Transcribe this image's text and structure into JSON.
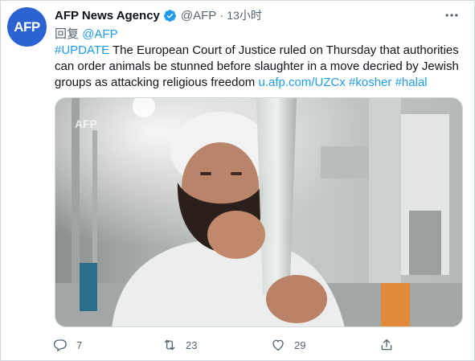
{
  "tweet": {
    "avatar_text": "AFP",
    "name": "AFP News Agency",
    "handle": "@AFP",
    "separator": "·",
    "time": "13小时",
    "reply_prefix": "回复",
    "reply_to": "@AFP",
    "text_hashtag": "#UPDATE",
    "text_body": " The European Court of Justice ruled on Thursday that authorities can order animals be stunned before slaughter in a move decried by Jewish groups as attacking religious freedom ",
    "text_link": "u.afp.com/UZCx",
    "text_hashtag_2": "#kosher",
    "text_hashtag_3": "#halal",
    "media_watermark": "AFP"
  },
  "actions": {
    "reply_count": "7",
    "retweet_count": "23",
    "like_count": "29"
  },
  "colors": {
    "accent": "#1d9bf0",
    "avatar_bg": "#2b63d3",
    "muted": "#536471"
  }
}
